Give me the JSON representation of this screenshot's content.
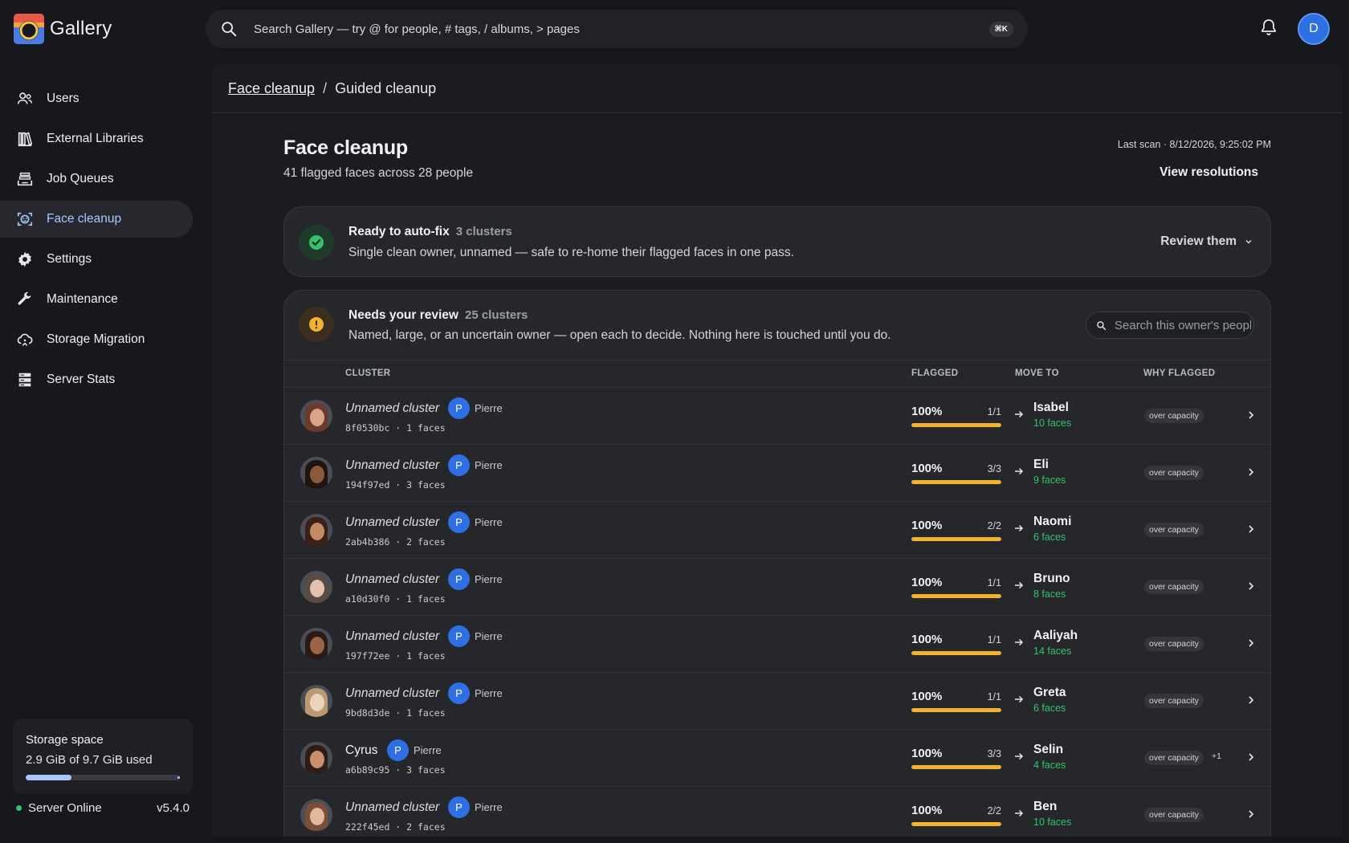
{
  "app": {
    "name": "Gallery",
    "user_initial": "D"
  },
  "search": {
    "placeholder": "Search Gallery — try @ for people, # tags, / albums, > pages",
    "shortcut": "⌘K"
  },
  "sidebar": {
    "items": [
      {
        "label": "Users",
        "icon": "users-icon"
      },
      {
        "label": "External Libraries",
        "icon": "library-icon"
      },
      {
        "label": "Job Queues",
        "icon": "job-queues-icon"
      },
      {
        "label": "Face cleanup",
        "icon": "face-cleanup-icon",
        "active": true
      },
      {
        "label": "Settings",
        "icon": "gear-icon"
      },
      {
        "label": "Maintenance",
        "icon": "wrench-icon"
      },
      {
        "label": "Storage Migration",
        "icon": "cloud-migration-icon"
      },
      {
        "label": "Server Stats",
        "icon": "server-stats-icon"
      }
    ],
    "storage": {
      "title": "Storage space",
      "used": "2.9 GiB of 9.7 GiB used",
      "fraction": 0.299
    },
    "server": {
      "status": "Server Online",
      "version": "v5.4.0"
    }
  },
  "breadcrumb": {
    "parent": "Face cleanup",
    "sep": "/",
    "current": "Guided cleanup"
  },
  "page": {
    "title": "Face cleanup",
    "subtitle": "41 flagged faces across 28 people",
    "last_scan": "Last scan · 8/12/2026, 9:25:02 PM",
    "view_resolutions": "View resolutions"
  },
  "auto_fix": {
    "title": "Ready to auto-fix",
    "count": "3 clusters",
    "desc": "Single clean owner, unnamed — safe to re-home their flagged faces in one pass.",
    "action": "Review them"
  },
  "review": {
    "title": "Needs your review",
    "count": "25 clusters",
    "desc": "Named, large, or an uncertain owner — open each to decide. Nothing here is touched until you do.",
    "search_placeholder": "Search this owner's people",
    "columns": {
      "cluster": "CLUSTER",
      "flagged": "FLAGGED",
      "move_to": "MOVE TO",
      "why": "WHY FLAGGED"
    },
    "rows": [
      {
        "name": "Unnamed cluster",
        "named": false,
        "owner_initial": "P",
        "owner": "Pierre",
        "meta": "8f0530bc · 1 faces",
        "pct": "100%",
        "ratio": "1/1",
        "fraction": 1,
        "move_name": "Isabel",
        "move_faces": "10 faces",
        "why": "over capacity",
        "extra": "",
        "tones": [
          "#d7a58a",
          "#6a3b2a"
        ]
      },
      {
        "name": "Unnamed cluster",
        "named": false,
        "owner_initial": "P",
        "owner": "Pierre",
        "meta": "194f97ed · 3 faces",
        "pct": "100%",
        "ratio": "3/3",
        "fraction": 1,
        "move_name": "Eli",
        "move_faces": "9 faces",
        "why": "over capacity",
        "extra": "",
        "tones": [
          "#8a5a3c",
          "#1e1511"
        ]
      },
      {
        "name": "Unnamed cluster",
        "named": false,
        "owner_initial": "P",
        "owner": "Pierre",
        "meta": "2ab4b386 · 2 faces",
        "pct": "100%",
        "ratio": "2/2",
        "fraction": 1,
        "move_name": "Naomi",
        "move_faces": "6 faces",
        "why": "over capacity",
        "extra": "",
        "tones": [
          "#c48a62",
          "#3a2016"
        ]
      },
      {
        "name": "Unnamed cluster",
        "named": false,
        "owner_initial": "P",
        "owner": "Pierre",
        "meta": "a10d30f0 · 1 faces",
        "pct": "100%",
        "ratio": "1/1",
        "fraction": 1,
        "move_name": "Bruno",
        "move_faces": "8 faces",
        "why": "over capacity",
        "extra": "",
        "tones": [
          "#e0c2ae",
          "#5a4a44"
        ]
      },
      {
        "name": "Unnamed cluster",
        "named": false,
        "owner_initial": "P",
        "owner": "Pierre",
        "meta": "197f72ee · 1 faces",
        "pct": "100%",
        "ratio": "1/1",
        "fraction": 1,
        "move_name": "Aaliyah",
        "move_faces": "14 faces",
        "why": "over capacity",
        "extra": "",
        "tones": [
          "#9a6446",
          "#2a1a14"
        ]
      },
      {
        "name": "Unnamed cluster",
        "named": false,
        "owner_initial": "P",
        "owner": "Pierre",
        "meta": "9bd8d3de · 1 faces",
        "pct": "100%",
        "ratio": "1/1",
        "fraction": 1,
        "move_name": "Greta",
        "move_faces": "6 faces",
        "why": "over capacity",
        "extra": "",
        "tones": [
          "#ead3bd",
          "#b99a72"
        ]
      },
      {
        "name": "Cyrus",
        "named": true,
        "owner_initial": "P",
        "owner": "Pierre",
        "meta": "a6b89c95 · 3 faces",
        "pct": "100%",
        "ratio": "3/3",
        "fraction": 1,
        "move_name": "Selin",
        "move_faces": "4 faces",
        "why": "over capacity",
        "extra": "+1",
        "tones": [
          "#c9906a",
          "#2d1d16"
        ]
      },
      {
        "name": "Unnamed cluster",
        "named": false,
        "owner_initial": "P",
        "owner": "Pierre",
        "meta": "222f45ed · 2 faces",
        "pct": "100%",
        "ratio": "2/2",
        "fraction": 1,
        "move_name": "Ben",
        "move_faces": "10 faces",
        "why": "over capacity",
        "extra": "",
        "tones": [
          "#e2b79a",
          "#7a4f3a"
        ]
      }
    ]
  },
  "colors": {
    "accent": "#a9c6ff",
    "progress": "#f3b32c",
    "success": "#34c16b",
    "owner_badge": "#2f6fe4"
  }
}
